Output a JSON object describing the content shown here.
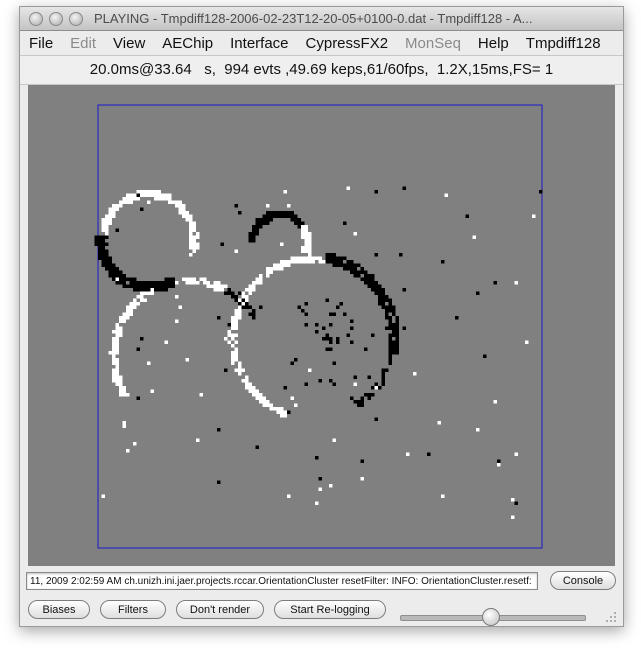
{
  "window": {
    "title": "PLAYING - Tmpdiff128-2006-02-23T12-20-05+0100-0.dat - Tmpdiff128 - A..."
  },
  "menubar": {
    "items": [
      {
        "label": "File",
        "enabled": true
      },
      {
        "label": "Edit",
        "enabled": false
      },
      {
        "label": "View",
        "enabled": true
      },
      {
        "label": "AEChip",
        "enabled": true
      },
      {
        "label": "Interface",
        "enabled": true
      },
      {
        "label": "CypressFX2",
        "enabled": true
      },
      {
        "label": "MonSeq",
        "enabled": false
      },
      {
        "label": "Help",
        "enabled": true
      },
      {
        "label": "Tmpdiff128",
        "enabled": true
      }
    ]
  },
  "status": {
    "text": "20.0ms@33.64   s,  994 evts ,49.69 keps,61/60fps,  1.2X,15ms,FS= 1"
  },
  "viewer": {
    "background": "#808080",
    "frame_color": "#1a1acc",
    "on_event_color": "#ffffff",
    "off_event_color": "#000000"
  },
  "console": {
    "log_text": "11, 2009 2:02:59 AM ch.unizh.ini.jaer.projects.rccar.OrientationCluster resetFilter: INFO: OrientationCluster.resetf:",
    "button_label": "Console"
  },
  "toolbar": {
    "biases_label": "Biases",
    "filters_label": "Filters",
    "dont_render_label": "Don't render",
    "start_relogging_label": "Start Re-logging",
    "playback_slider_value": 0.49
  }
}
